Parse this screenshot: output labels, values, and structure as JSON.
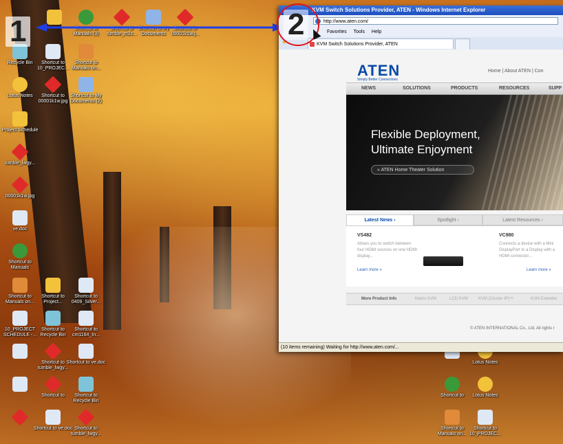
{
  "step_numbers": [
    "1",
    "2"
  ],
  "colors": {
    "arrow": "#1e3fe8",
    "circle": "#e0141b",
    "brand": "#0a4aa8"
  },
  "desktop": {
    "icons": [
      {
        "label": "",
        "icon": "folder-icon",
        "color": "#f2c23b"
      },
      {
        "label": "Shortcut to Manuals (3)",
        "icon": "shortcut-icon",
        "color": "#3a9a3a"
      },
      {
        "label": "Shortcut to tumble_m2c...",
        "icon": "image-icon",
        "color": "#e02a2a"
      },
      {
        "label": "Shortcut to My Documents",
        "icon": "documents-icon",
        "color": "#8fb5e8"
      },
      {
        "label": "Shortcut to 00001k1w.j...",
        "icon": "image-icon",
        "color": "#e02a2a"
      },
      {
        "label": "Recycle Bin",
        "icon": "recycle-bin-icon",
        "color": "#7fc3d9"
      },
      {
        "label": "Shortcut to 10_PROJEC...",
        "icon": "document-icon",
        "color": "#dfe8f5"
      },
      {
        "label": "Shortcut to Manuals on...",
        "icon": "users-icon",
        "color": "#e08a3a"
      },
      {
        "label": "Lotus Notes",
        "icon": "lotus-notes-icon",
        "color": "#f2c23b"
      },
      {
        "label": "Shortcut to 00001k1w.jpg",
        "icon": "image-icon",
        "color": "#e02a2a"
      },
      {
        "label": "Shortcut to My Documents (2)",
        "icon": "documents-icon",
        "color": "#8fb5e8"
      },
      {
        "label": "Project Schedule",
        "icon": "folder-icon",
        "color": "#f2c23b"
      },
      {
        "label": "tumble_lwgy...",
        "icon": "image-icon",
        "color": "#e02a2a"
      },
      {
        "label": "00001k1w.jpg",
        "icon": "image-icon",
        "color": "#e02a2a"
      },
      {
        "label": "ve.doc",
        "icon": "word-doc-icon",
        "color": "#dfe8f5"
      },
      {
        "label": "Shortcut to Manuals",
        "icon": "shortcut-icon",
        "color": "#3a9a3a"
      },
      {
        "label": "Shortcut to Manuals on...",
        "icon": "users-icon",
        "color": "#e08a3a"
      },
      {
        "label": "Shortcut to Project...",
        "icon": "folder-icon",
        "color": "#f2c23b"
      },
      {
        "label": "Shortcut to 0409_Silver...",
        "icon": "document-icon",
        "color": "#dfe8f5"
      },
      {
        "label": "10_PROJECT SCHEDULE -...",
        "icon": "document-icon",
        "color": "#dfe8f5"
      },
      {
        "label": "Shortcut to Recycle Bin",
        "icon": "recycle-bin-icon",
        "color": "#7fc3d9"
      },
      {
        "label": "Shortcut to cm1164_In...",
        "icon": "document-icon",
        "color": "#dfe8f5"
      },
      {
        "label": "",
        "icon": "document-icon",
        "color": "#dfe8f5"
      },
      {
        "label": "Shortcut to tumble_lwgy...",
        "icon": "image-icon",
        "color": "#e02a2a"
      },
      {
        "label": "Shortcut to ve.doc",
        "icon": "word-doc-icon",
        "color": "#dfe8f5"
      },
      {
        "label": "",
        "icon": "document-icon",
        "color": "#dfe8f5"
      },
      {
        "label": "Shortcut to",
        "icon": "image-icon",
        "color": "#e02a2a"
      },
      {
        "label": "Shortcut to Recycle Bin",
        "icon": "recycle-bin-icon",
        "color": "#7fc3d9"
      },
      {
        "label": "",
        "icon": "image-icon",
        "color": "#e02a2a"
      },
      {
        "label": "Shortcut to ve.doc",
        "icon": "word-doc-icon",
        "color": "#dfe8f5"
      },
      {
        "label": "Shortcut to tumble_lwgy...",
        "icon": "image-icon",
        "color": "#e02a2a"
      },
      {
        "label": "",
        "icon": "document-icon",
        "color": "#dfe8f5"
      },
      {
        "label": "Lotus Notes",
        "icon": "lotus-notes-icon",
        "color": "#f2c23b"
      },
      {
        "label": "Shortcut to",
        "icon": "shortcut-icon",
        "color": "#3a9a3a"
      },
      {
        "label": "Lotus Notes",
        "icon": "lotus-notes-icon",
        "color": "#f2c23b"
      },
      {
        "label": "Shortcut to Manuals on...",
        "icon": "users-icon",
        "color": "#e08a3a"
      },
      {
        "label": "Shortcut to 10_PROJEC...",
        "icon": "document-icon",
        "color": "#dfe8f5"
      }
    ]
  },
  "browser": {
    "title": "KVM Switch Solutions Provider, ATEN - Windows Internet Explorer",
    "address": "http://www.aten.com/",
    "menu": [
      "Favorites",
      "Tools",
      "Help"
    ],
    "tab_title": "KVM Switch Solutions Provider, ATEN",
    "status": "(10 items remaining) Waiting for http://www.aten.com/...",
    "page": {
      "logo": "ATEN",
      "logo_tagline": "Simply Better Connections",
      "top_links": "Home  |  About ATEN  |  Con",
      "nav": [
        "NEWS",
        "SOLUTIONS",
        "PRODUCTS",
        "RESOURCES",
        "SUPP"
      ],
      "hero_line1": "Flexible Deployment,",
      "hero_line2": "Ultimate Enjoyment",
      "hero_button": "» ATEN Home Theater Solution",
      "news_tabs": [
        "Latest News ›",
        "Spotlight ›",
        "Latest Resources ›"
      ],
      "news": [
        {
          "title": "VS482",
          "text": "Allows you to switch between four HDMI sources on one HDMI display...",
          "more": "Learn more »"
        },
        {
          "title": "VC980",
          "text": "Connects a device with a Mini DisplayPort to a Display with a HDMI connector...",
          "more": "Learn more »"
        }
      ],
      "product_info_label": "More Product Info",
      "product_links": [
        "Matrix KVM",
        "LCD KVM",
        "KVM (Cluster IP)™",
        "KVM Extender"
      ],
      "copyright": "© ATEN INTERNATIONAL Co., Ltd. All rights r"
    }
  }
}
